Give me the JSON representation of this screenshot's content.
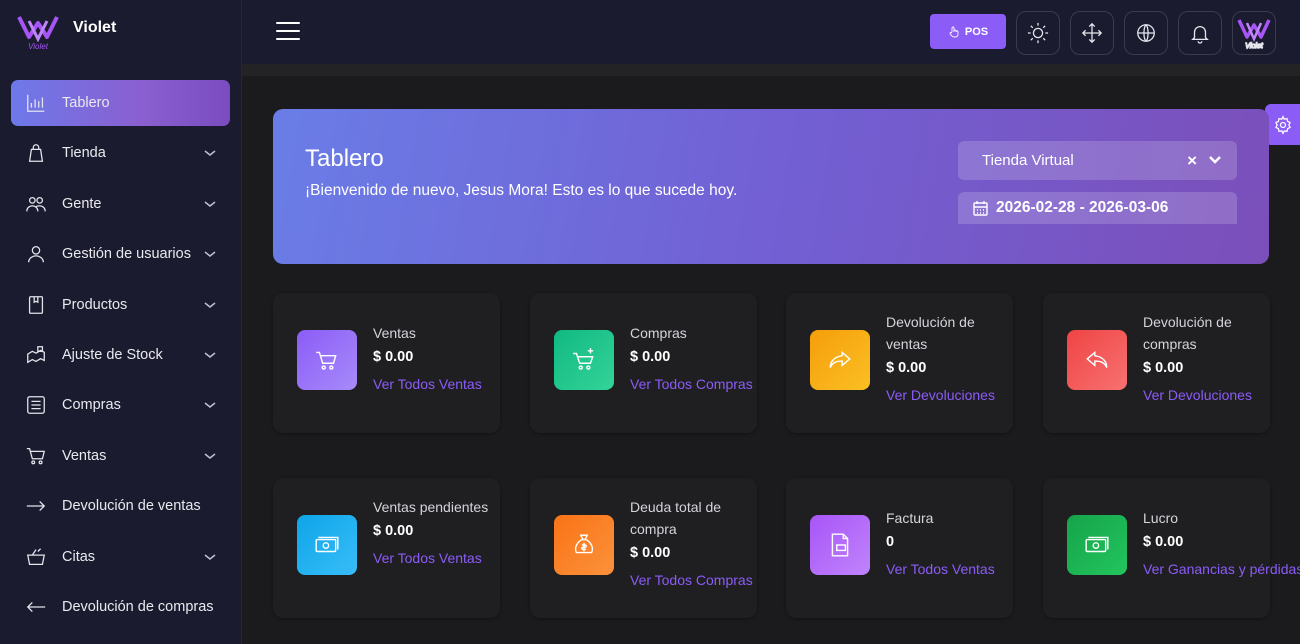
{
  "brand": {
    "name": "Violet",
    "logo_text": "Violet"
  },
  "sidebar": {
    "items": [
      {
        "label": "Tablero",
        "icon": "chart-icon",
        "active": true,
        "has_submenu": false
      },
      {
        "label": "Tienda",
        "icon": "shopping-bag-icon",
        "has_submenu": true
      },
      {
        "label": "Gente",
        "icon": "people-icon",
        "has_submenu": true
      },
      {
        "label": "Gestión de usuarios",
        "icon": "user-icon",
        "has_submenu": true
      },
      {
        "label": "Productos",
        "icon": "product-icon",
        "has_submenu": true
      },
      {
        "label": "Ajuste de Stock",
        "icon": "stock-icon",
        "has_submenu": true
      },
      {
        "label": "Compras",
        "icon": "receipt-icon",
        "has_submenu": true
      },
      {
        "label": "Ventas",
        "icon": "cart-icon",
        "has_submenu": true
      },
      {
        "label": "Devolución de ventas",
        "icon": "arrow-right-icon",
        "has_submenu": false
      },
      {
        "label": "Citas",
        "icon": "basket-icon",
        "has_submenu": true
      },
      {
        "label": "Devolución de compras",
        "icon": "arrow-left-icon",
        "has_submenu": false
      }
    ]
  },
  "topbar": {
    "pos_label": "POS",
    "icons": [
      "sun-icon",
      "fullscreen-icon",
      "globe-icon",
      "bell-icon",
      "avatar"
    ]
  },
  "banner": {
    "title": "Tablero",
    "welcome": "¡Bienvenido de nuevo, Jesus Mora! Esto es lo que sucede hoy.",
    "store": "Tienda Virtual",
    "clear": "×",
    "date_range": "2026-02-28 - 2026-03-06"
  },
  "cards": [
    {
      "label": "Ventas",
      "value": "$ 0.00",
      "link": "Ver Todos Ventas",
      "icon": "cart-icon",
      "color": "#8b5cf6"
    },
    {
      "label": "Compras",
      "value": "$ 0.00",
      "link": "Ver Todos Compras",
      "icon": "cart-add-icon",
      "color": "#10b981"
    },
    {
      "label": "Devolución de ventas",
      "value": "$ 0.00",
      "link": "Ver Devoluciones",
      "icon": "share-arrow-icon",
      "color": "#f59e0b"
    },
    {
      "label": "Devolución de compras",
      "value": "$ 0.00",
      "link": "Ver Devoluciones",
      "icon": "reply-arrow-icon",
      "color": "#ef4444"
    },
    {
      "label": "Ventas pendientes",
      "value": "$ 0.00",
      "link": "Ver Todos Ventas",
      "icon": "cash-icon",
      "color": "#0ea5e9"
    },
    {
      "label": "Deuda total de compra",
      "value": "$ 0.00",
      "link": "Ver Todos Compras",
      "icon": "money-bag-icon",
      "color": "#f97316"
    },
    {
      "label": "Factura",
      "value": "0",
      "link": "Ver Todos Ventas",
      "icon": "invoice-icon",
      "color": "#a855f7"
    },
    {
      "label": "Lucro",
      "value": "$ 0.00",
      "link": "Ver Ganancias y pérdidas",
      "icon": "cash-icon",
      "color": "#16a34a"
    }
  ]
}
